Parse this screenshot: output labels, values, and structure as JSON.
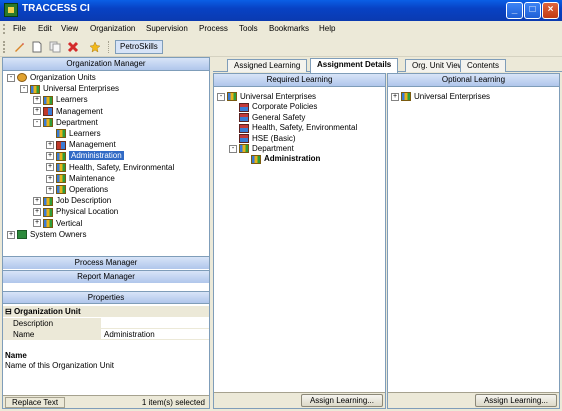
{
  "window": {
    "title": "TRACCESS CI"
  },
  "menu": [
    "File",
    "Edit",
    "View",
    "Organization",
    "Supervision",
    "Process",
    "Tools",
    "Bookmarks",
    "Help"
  ],
  "toolbar": {
    "petroskills_label": "PetroSkills"
  },
  "left": {
    "org_manager_title": "Organization Manager",
    "tree": [
      {
        "label": "Organization Units",
        "level": 0,
        "exp": "-",
        "icon": "root"
      },
      {
        "label": "Universal Enterprises",
        "level": 1,
        "exp": "-",
        "icon": "org"
      },
      {
        "label": "Learners",
        "level": 2,
        "exp": "+",
        "icon": "org"
      },
      {
        "label": "Management",
        "level": 2,
        "exp": "+",
        "icon": "mgmt"
      },
      {
        "label": "Department",
        "level": 2,
        "exp": "-",
        "icon": "org"
      },
      {
        "label": "Learners",
        "level": 3,
        "exp": "",
        "icon": "org"
      },
      {
        "label": "Management",
        "level": 3,
        "exp": "+",
        "icon": "mgmt"
      },
      {
        "label": "Administration",
        "level": 3,
        "exp": "+",
        "icon": "org",
        "selected": true
      },
      {
        "label": "Health, Safety, Environmental",
        "level": 3,
        "exp": "+",
        "icon": "org"
      },
      {
        "label": "Maintenance",
        "level": 3,
        "exp": "+",
        "icon": "org"
      },
      {
        "label": "Operations",
        "level": 3,
        "exp": "+",
        "icon": "org"
      },
      {
        "label": "Job Description",
        "level": 2,
        "exp": "+",
        "icon": "org"
      },
      {
        "label": "Physical Location",
        "level": 2,
        "exp": "+",
        "icon": "org"
      },
      {
        "label": "Vertical",
        "level": 2,
        "exp": "+",
        "icon": "org"
      },
      {
        "label": "System Owners",
        "level": 0,
        "exp": "+",
        "icon": "green"
      }
    ],
    "process_manager": "Process Manager",
    "report_manager": "Report Manager",
    "properties_title": "Properties",
    "prop_category": "Organization Unit",
    "props": [
      {
        "key": "Description",
        "value": ""
      },
      {
        "key": "Name",
        "value": "Administration"
      }
    ],
    "desc_title": "Name",
    "desc_text": "Name of this Organization Unit",
    "replace_text": "Replace Text",
    "status_text": "1 item(s) selected"
  },
  "tabs": [
    "Assigned Learning",
    "Assignment Details",
    "Org. Unit Views",
    "Contents"
  ],
  "active_tab": "Assignment Details",
  "required": {
    "title": "Required Learning",
    "tree": [
      {
        "label": "Universal Enterprises",
        "level": 0,
        "exp": "-",
        "icon": "org"
      },
      {
        "label": "Corporate Policies",
        "level": 1,
        "exp": "",
        "icon": "course"
      },
      {
        "label": "General Safety",
        "level": 1,
        "exp": "",
        "icon": "course"
      },
      {
        "label": "Health, Safety, Environmental",
        "level": 1,
        "exp": "",
        "icon": "course"
      },
      {
        "label": "HSE (Basic)",
        "level": 1,
        "exp": "",
        "icon": "course"
      },
      {
        "label": "Department",
        "level": 1,
        "exp": "-",
        "icon": "org"
      },
      {
        "label": "Administration",
        "level": 2,
        "exp": "",
        "icon": "org",
        "bold": true
      }
    ],
    "assign_label": "Assign Learning..."
  },
  "optional": {
    "title": "Optional Learning",
    "tree": [
      {
        "label": "Universal Enterprises",
        "level": 0,
        "exp": "+",
        "icon": "org"
      }
    ],
    "assign_label": "Assign Learning..."
  }
}
